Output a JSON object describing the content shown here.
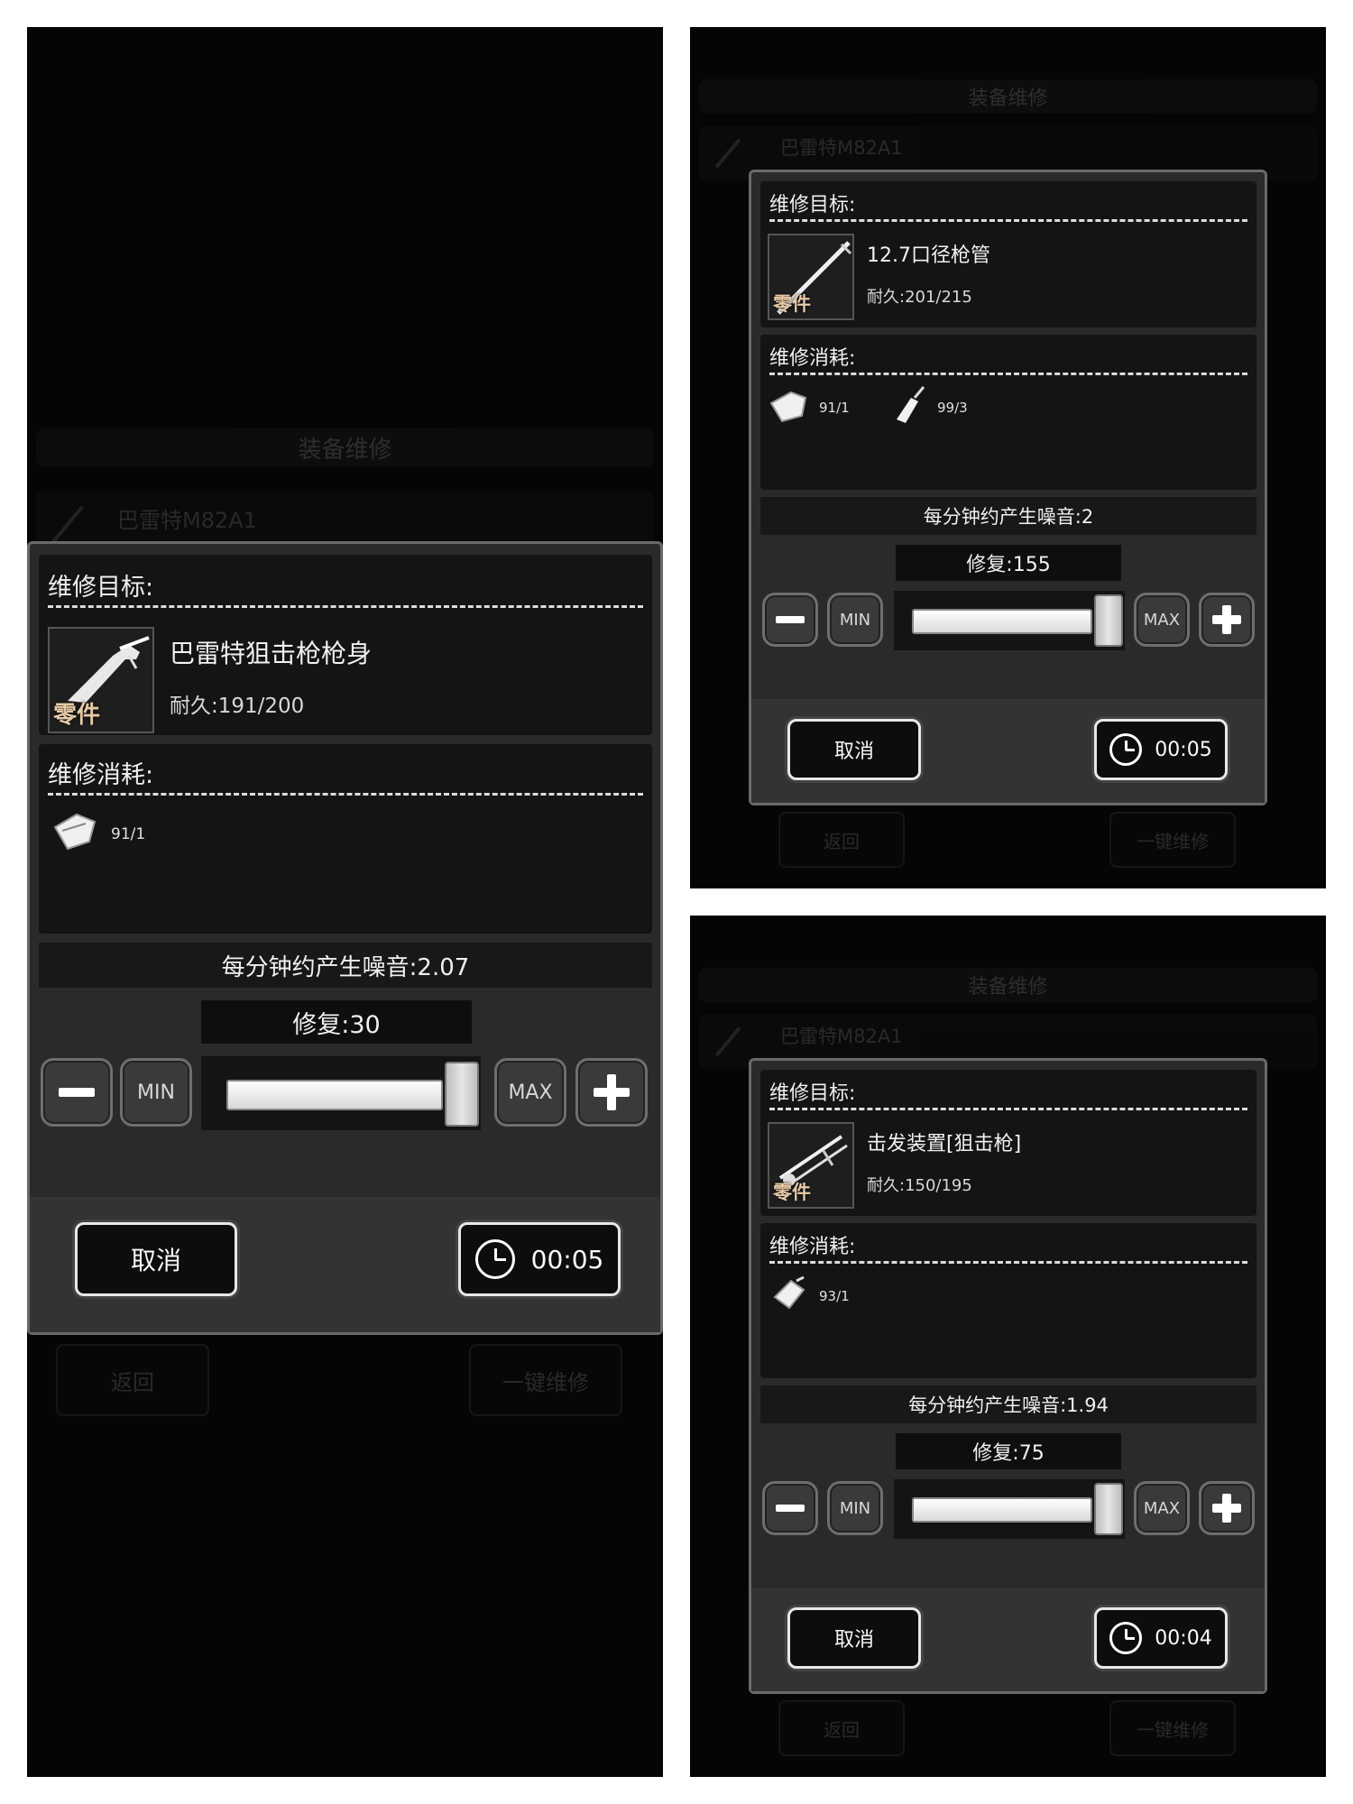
{
  "background": {
    "title": "装备维修",
    "weapon": "巴雷特M82A1",
    "back_label": "返回",
    "repair_all_label": "一键维修"
  },
  "panels": [
    {
      "target_title": "维修目标:",
      "part_label": "零件",
      "item_name": "巴雷特狙击枪枪身",
      "durability": "耐久:191/200",
      "cost_title": "维修消耗:",
      "costs": [
        {
          "icon": "cloth-icon",
          "text": "91/1"
        }
      ],
      "noise": "每分钟约产生噪音:2.07",
      "repair": "修复:30",
      "min_label": "MIN",
      "max_label": "MAX",
      "slider_fraction": 1.0,
      "cancel_label": "取消",
      "timer": "00:05"
    },
    {
      "target_title": "维修目标:",
      "part_label": "零件",
      "item_name": "12.7口径枪管",
      "durability": "耐久:201/215",
      "cost_title": "维修消耗:",
      "costs": [
        {
          "icon": "cloth-icon",
          "text": "91/1"
        },
        {
          "icon": "oil-bottle-icon",
          "text": "99/3"
        }
      ],
      "noise": "每分钟约产生噪音:2",
      "repair": "修复:155",
      "min_label": "MIN",
      "max_label": "MAX",
      "slider_fraction": 1.0,
      "cancel_label": "取消",
      "timer": "00:05"
    },
    {
      "target_title": "维修目标:",
      "part_label": "零件",
      "item_name": "击发装置[狙击枪]",
      "durability": "耐久:150/195",
      "cost_title": "维修消耗:",
      "costs": [
        {
          "icon": "tape-icon",
          "text": "93/1"
        }
      ],
      "noise": "每分钟约产生噪音:1.94",
      "repair": "修复:75",
      "min_label": "MIN",
      "max_label": "MAX",
      "slider_fraction": 1.0,
      "cancel_label": "取消",
      "timer": "00:04"
    }
  ]
}
